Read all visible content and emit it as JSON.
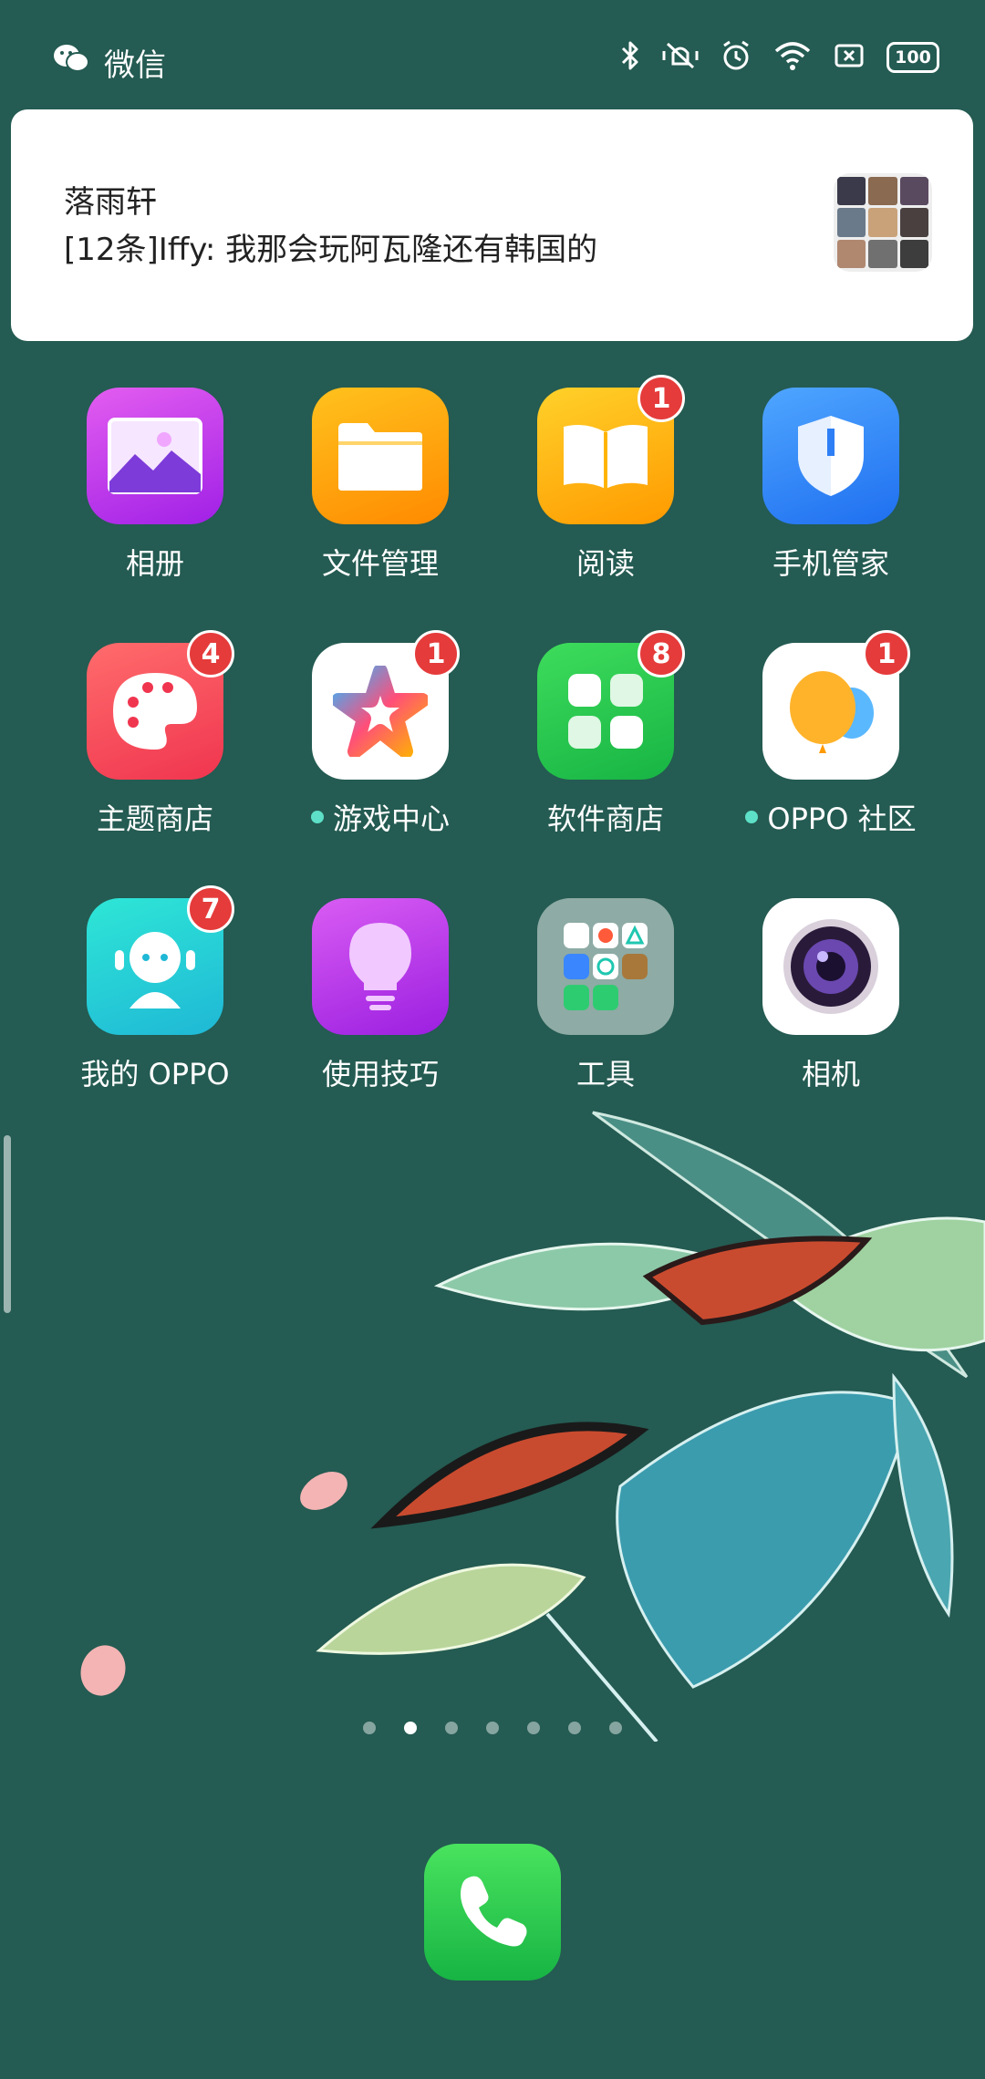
{
  "status_bar": {
    "app_name": "微信",
    "battery": "100"
  },
  "notification": {
    "title": "落雨轩",
    "message": "[12条]Iffy: 我那会玩阿瓦隆还有韩国的"
  },
  "apps": [
    {
      "label": "相册",
      "badge": ""
    },
    {
      "label": "文件管理",
      "badge": ""
    },
    {
      "label": "阅读",
      "badge": "1"
    },
    {
      "label": "手机管家",
      "badge": ""
    },
    {
      "label": "主题商店",
      "badge": "4"
    },
    {
      "label": "游戏中心",
      "badge": "1"
    },
    {
      "label": "软件商店",
      "badge": "8"
    },
    {
      "label": "OPPO 社区",
      "badge": "1"
    },
    {
      "label": "我的 OPPO",
      "badge": "7"
    },
    {
      "label": "使用技巧",
      "badge": ""
    },
    {
      "label": "工具",
      "badge": ""
    },
    {
      "label": "相机",
      "badge": ""
    }
  ],
  "pager": {
    "count": 7,
    "active": 2
  },
  "colors": {
    "wallpaper": "#245b52",
    "badge": "#e53b3b",
    "new_dot": "#5de0c7"
  }
}
